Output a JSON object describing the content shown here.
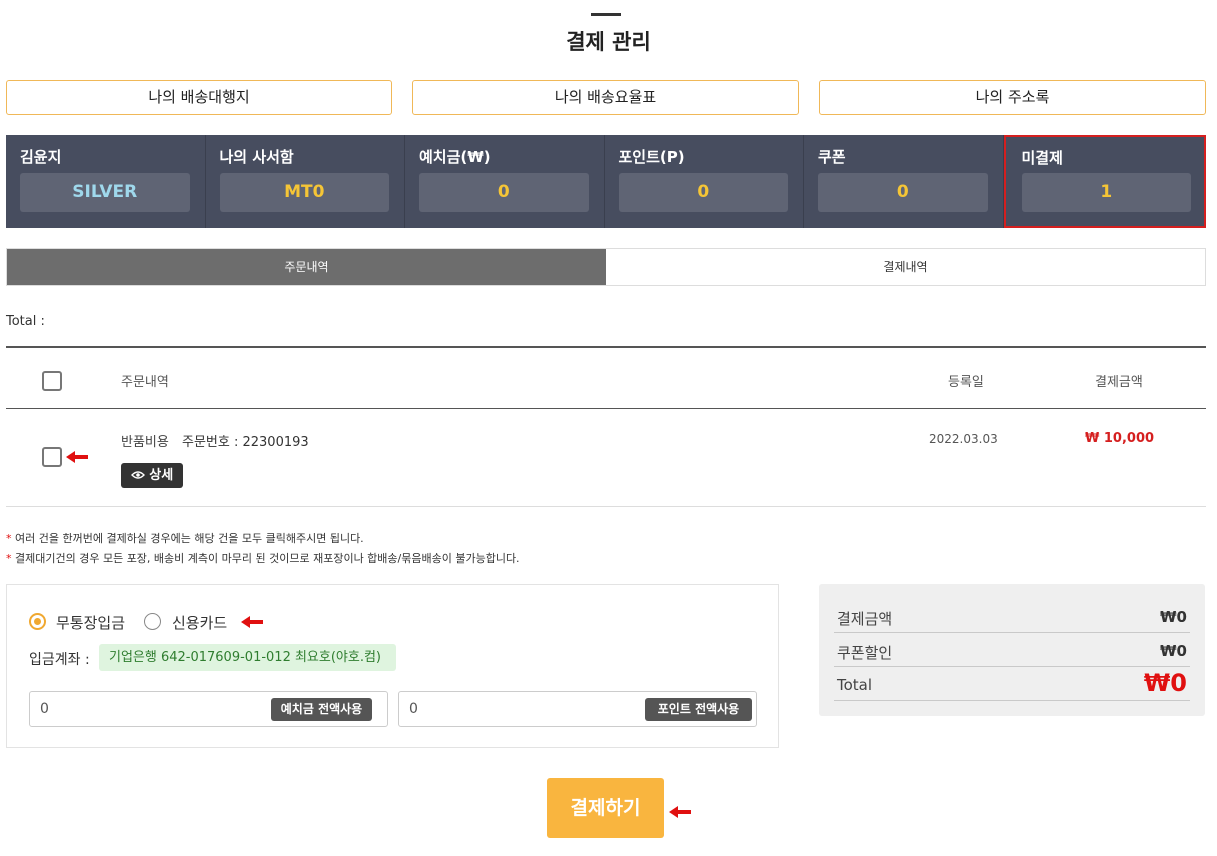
{
  "page": {
    "title": "결제 관리"
  },
  "links": [
    "나의 배송대행지",
    "나의 배송요율표",
    "나의 주소록"
  ],
  "stats": [
    {
      "label": "김윤지",
      "value": "SILVER"
    },
    {
      "label": "나의 사서함",
      "value": "MT0"
    },
    {
      "label": "예치금(₩)",
      "value": "0"
    },
    {
      "label": "포인트(P)",
      "value": "0"
    },
    {
      "label": "쿠폰",
      "value": "0"
    },
    {
      "label": "미결제",
      "value": "1"
    }
  ],
  "tabs": [
    "주문내역",
    "결제내역"
  ],
  "total_label": "Total :",
  "table": {
    "headers": {
      "order": "주문내역",
      "date": "등록일",
      "amount": "결제금액"
    },
    "rows": [
      {
        "type": "반품비용",
        "order_no": "주문번호 : 22300193",
        "detail_label": "상세",
        "date": "2022.03.03",
        "amount": "₩ 10,000"
      }
    ]
  },
  "notes": [
    "여러 건을 한꺼번에 결제하실 경우에는 해당 건을 모두 클릭해주시면 됩니다.",
    "결제대기건의 경우 모든 포장, 배송비 계측이 마무리 된 것이므로 재포장이나 합배송/묶음배송이 불가능합니다."
  ],
  "payment": {
    "methods": [
      "무통장입금",
      "신용카드"
    ],
    "selected_method": "무통장입금",
    "account_label": "입금계좌 :",
    "account_value": "기업은행  642-017609-01-012 최요호(야호.컴)",
    "deposit_input_value": "0",
    "deposit_button": "예치금 전액사용",
    "point_input_value": "0",
    "point_button": "포인트 전액사용"
  },
  "summary": {
    "amount_label": "결제금액",
    "amount_value": "₩0",
    "coupon_label": "쿠폰할인",
    "coupon_value": "₩0",
    "total_label": "Total",
    "total_value": "₩0"
  },
  "submit_label": "결제하기",
  "colors": {
    "accent": "#f9b53f",
    "header_bar": "#474d5f",
    "alert": "#e01010",
    "tier": "#9fd8ec",
    "stat_value": "#f5c536"
  }
}
